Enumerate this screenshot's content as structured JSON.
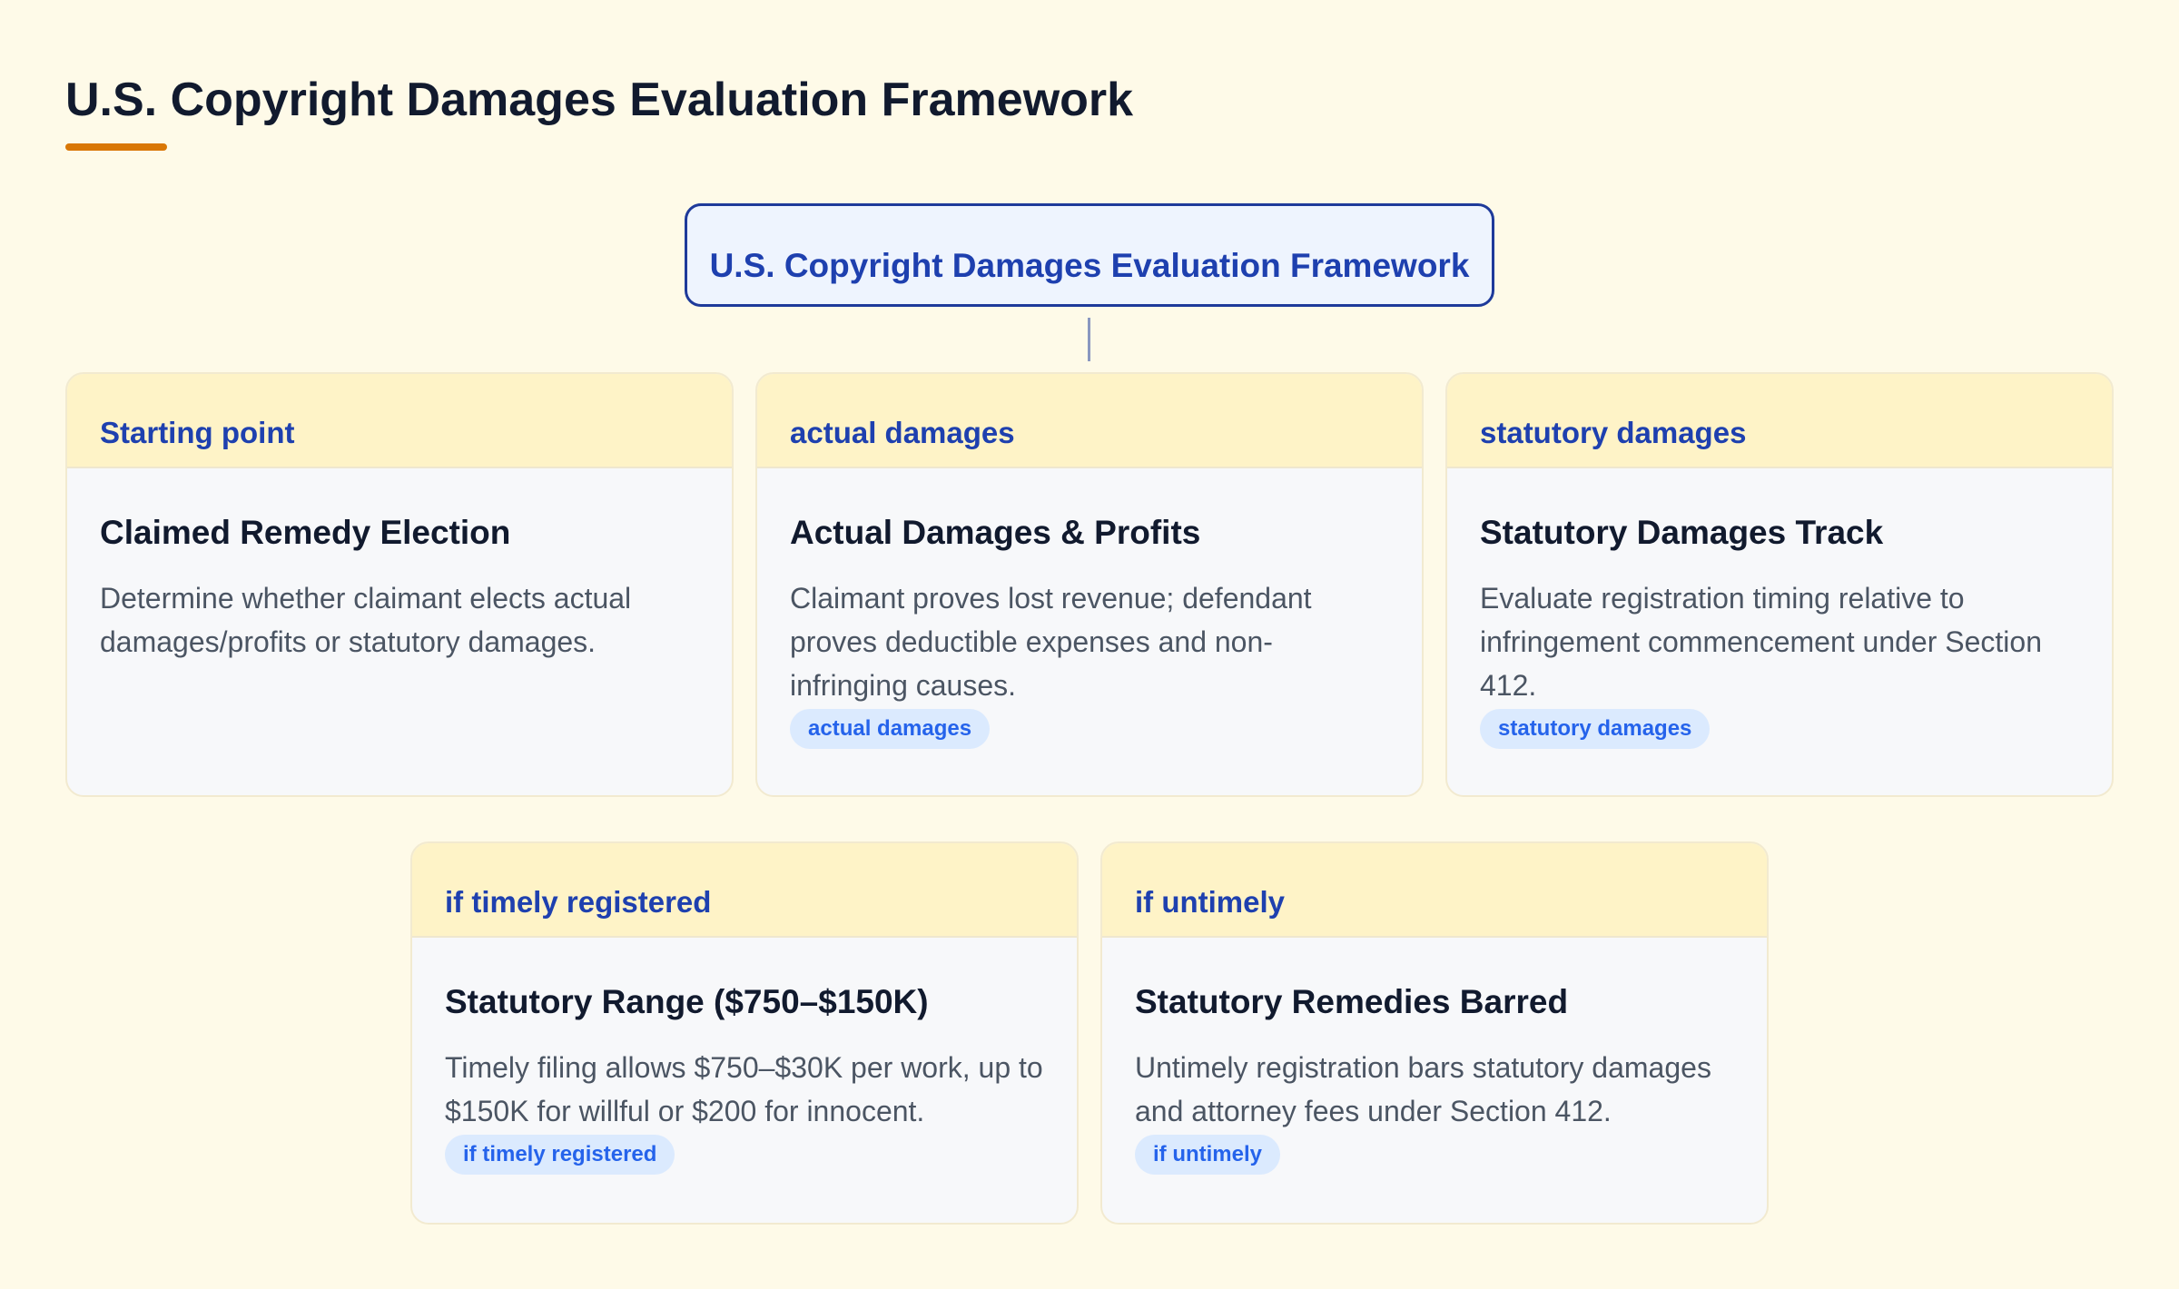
{
  "page": {
    "title": "U.S. Copyright Damages Evaluation Framework"
  },
  "root": {
    "label": "U.S. Copyright Damages Evaluation Framework"
  },
  "cards": [
    {
      "header": "Starting point",
      "title": "Claimed Remedy Election",
      "description": "Determine whether claimant elects actual damages/profits or statutory damages.",
      "tag": ""
    },
    {
      "header": "actual damages",
      "title": "Actual Damages & Profits",
      "description": "Claimant proves lost revenue; defendant proves deductible expenses and non-infringing causes.",
      "tag": "actual damages"
    },
    {
      "header": "statutory damages",
      "title": "Statutory Damages Track",
      "description": "Evaluate registration timing relative to infringement commencement under Section 412.",
      "tag": "statutory damages"
    },
    {
      "header": "if timely registered",
      "title": "Statutory Range ($750–$150K)",
      "description": "Timely filing allows $750–$30K per work, up to $150K for willful or $200 for innocent.",
      "tag": "if timely registered"
    },
    {
      "header": "if untimely",
      "title": "Statutory Remedies Barred",
      "description": "Untimely registration bars statutory damages and attorney fees under Section 412.",
      "tag": "if untimely"
    }
  ],
  "colors": {
    "background": "#fefae8",
    "accent": "#d97706",
    "node_border": "#1e3a9a",
    "header_fill": "#fef3c7",
    "tag_fill": "#dbeafe",
    "tag_text": "#2563eb"
  }
}
